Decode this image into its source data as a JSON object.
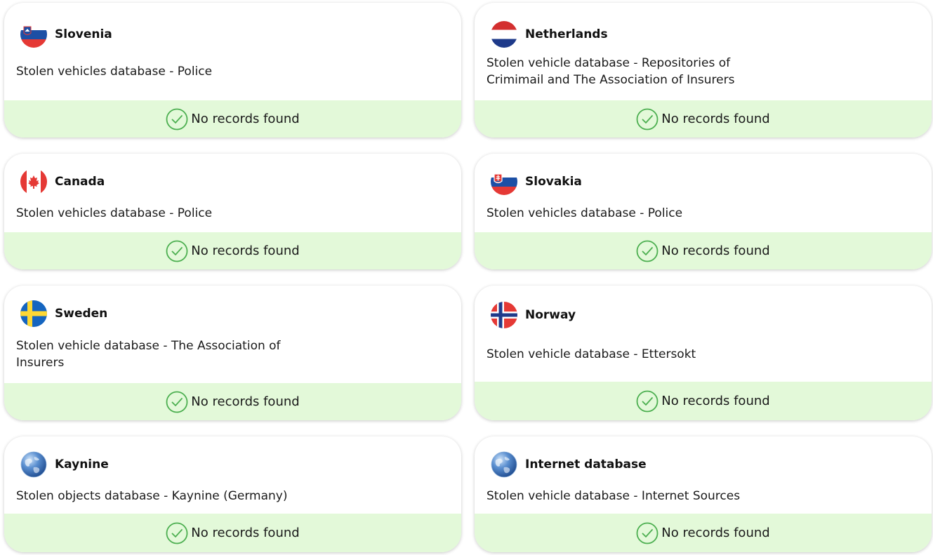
{
  "cards": [
    {
      "country": "Slovenia",
      "description": "Stolen vehicles database - Police",
      "status": "No records found",
      "icon": "slovenia-flag-icon"
    },
    {
      "country": "Netherlands",
      "description": "Stolen vehicle database - Repositories of Crimimail and The Association of Insurers",
      "status": "No records found",
      "icon": "netherlands-flag-icon"
    },
    {
      "country": "Canada",
      "description": "Stolen vehicles database - Police",
      "status": "No records found",
      "icon": "canada-flag-icon"
    },
    {
      "country": "Slovakia",
      "description": "Stolen vehicles database - Police",
      "status": "No records found",
      "icon": "slovakia-flag-icon"
    },
    {
      "country": "Sweden",
      "description": "Stolen vehicle database - The Association of Insurers",
      "status": "No records found",
      "icon": "sweden-flag-icon"
    },
    {
      "country": "Norway",
      "description": "Stolen vehicle database - Ettersokt",
      "status": "No records found",
      "icon": "norway-flag-icon"
    },
    {
      "country": "Kaynine",
      "description": "Stolen objects database - Kaynine (Germany)",
      "status": "No records found",
      "icon": "globe-icon"
    },
    {
      "country": "Internet database",
      "description": "Stolen vehicle database - Internet Sources",
      "status": "No records found",
      "icon": "globe-icon"
    }
  ],
  "colors": {
    "status_background": "#e3f9d9",
    "check_green": "#4caf50"
  }
}
